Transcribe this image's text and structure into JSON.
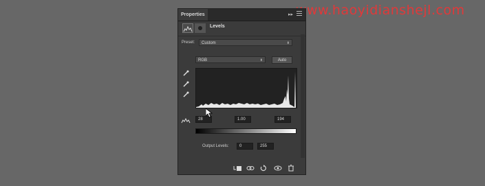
{
  "watermark": "www.haoyidianshejl.com",
  "panel": {
    "tab_title": "Properties",
    "collapse_glyph": "▸▸",
    "adjustment_title": "Levels",
    "preset_label": "Preset:",
    "preset_value": "Custom",
    "channel_value": "RGB",
    "auto_label": "Auto",
    "input_levels": {
      "black": "28",
      "gamma": "1.00",
      "white": "194"
    },
    "output_label": "Output Levels:",
    "output_levels": {
      "black": "0",
      "white": "255"
    }
  },
  "icons": {
    "titlebar": [
      "collapse-icon",
      "panel-menu-icon"
    ],
    "header": [
      "levels-adjustment-icon",
      "layer-mask-icon"
    ],
    "eyedroppers": [
      "black-point-eyedropper-icon",
      "gray-point-eyedropper-icon",
      "white-point-eyedropper-icon"
    ],
    "bottom": [
      "clip-to-layer-icon",
      "view-previous-state-icon",
      "reset-icon",
      "visibility-eye-icon",
      "delete-icon"
    ]
  },
  "colors": {
    "panel_bg": "#3b3b3b",
    "background": "#676767",
    "watermark": "#e0393a",
    "histogram_fill": "#e8e8e8"
  }
}
